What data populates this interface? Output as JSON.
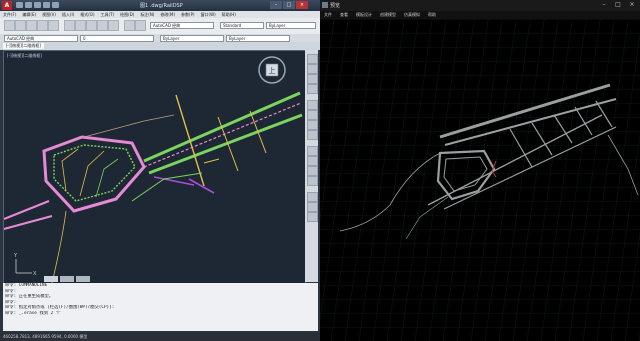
{
  "cad": {
    "logo": "A",
    "title": "图1 .dwg/RailDSP",
    "menu": [
      "文件(F)",
      "编辑(E)",
      "视图(V)",
      "插入(I)",
      "格式(O)",
      "工具(T)",
      "绘图(D)",
      "标注(N)",
      "修改(M)",
      "参数(P)",
      "窗口(W)",
      "帮助(H)"
    ],
    "combos": {
      "workspace": "AutoCAD 经典",
      "layer": "0",
      "color": "ByLayer",
      "style": "Standard",
      "linetype": "ByLayer"
    },
    "tab_label": "[-][俯视][二维线框]",
    "compass_center": "上",
    "command_lines": [
      "命令: COMMANDLINE",
      "命令:",
      "命令: 正在重生成模型。",
      "命令:",
      "命令: 指定对角点或 [栏选(F)/圈围(WP)/圈交(CP)]:",
      "命令: _.erase 找到 2 个"
    ],
    "status_text": "460258.7813, 4891665.9594, 0.0000   模型"
  },
  "viewer": {
    "title": "预览",
    "menu": [
      "文件",
      "查看",
      "模板设计",
      "创建模型",
      "仿真模拟",
      "帮助"
    ]
  },
  "colors": {
    "cad_background": "#1e2734",
    "viewer_background": "#000000",
    "road_pink": "#e58ad4",
    "road_green": "#7cd35f",
    "road_yellow": "#e0c04a",
    "road_purple": "#a64fd6",
    "viewer_grid": "#1c2b2b",
    "viewer_road": "#9aa0a0"
  }
}
